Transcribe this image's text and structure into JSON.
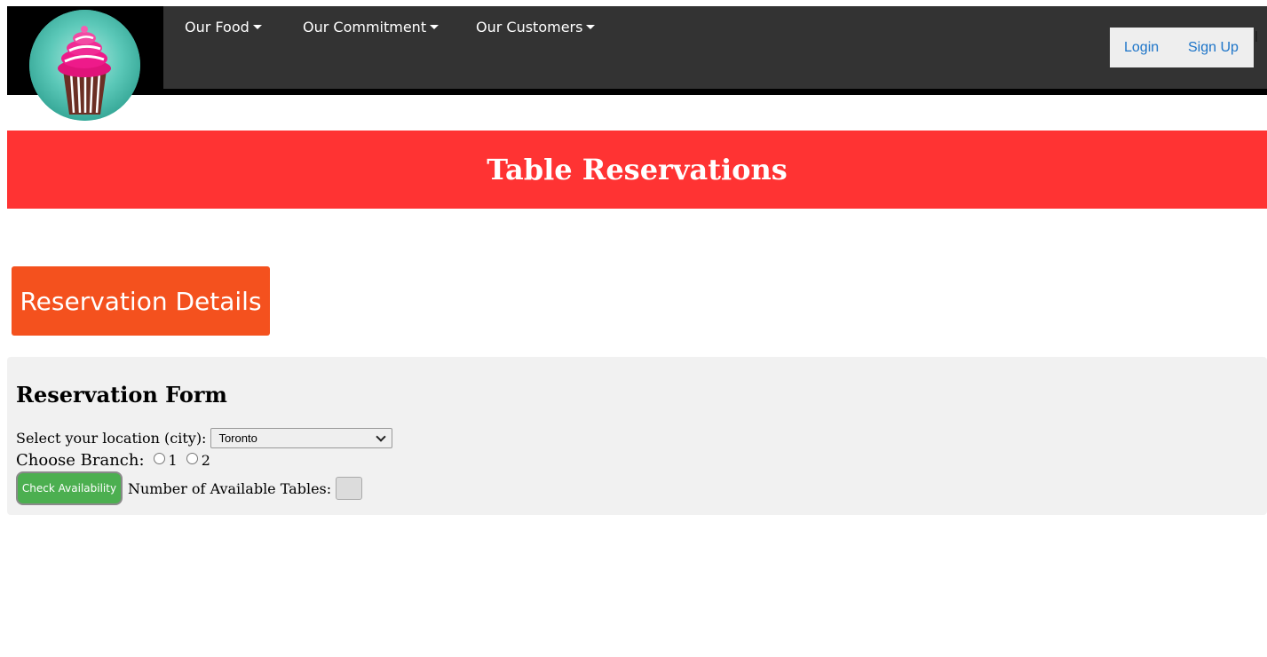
{
  "header": {
    "logo_alt": "cupcake-logo",
    "nav": [
      {
        "label": "Our Food",
        "icon": "caret-down-icon"
      },
      {
        "label": "Our Commitment",
        "icon": "caret-down-icon"
      },
      {
        "label": "Our Customers",
        "icon": "caret-down-icon"
      }
    ],
    "auth": {
      "login": "Login",
      "signup": "Sign Up"
    }
  },
  "banner": {
    "title": "Table Reservations"
  },
  "details_button": {
    "label": "Reservation Details"
  },
  "form": {
    "title": "Reservation Form",
    "location_label": "Select your location (city):",
    "location_value": "Toronto",
    "branch_label": "Choose Branch:",
    "branch_options": [
      "1",
      "2"
    ],
    "check_button": "Check Availability",
    "available_label": "Number of Available Tables:",
    "available_value": ""
  },
  "colors": {
    "navbar": "#333333",
    "banner": "#ff3333",
    "details_button": "#f4511e",
    "check_button": "#4caf50",
    "link": "#1a73c8"
  }
}
